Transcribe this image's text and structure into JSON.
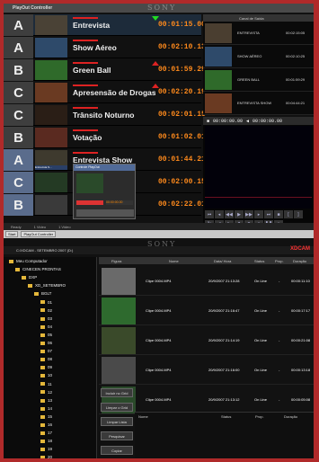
{
  "window": {
    "title": "PlayOut Controller",
    "brand": "SONY"
  },
  "playlist": [
    {
      "letter": "A",
      "name": "Entrevista",
      "tc": "00:01:15.00",
      "thumb": "#4a4236",
      "mark": "green"
    },
    {
      "letter": "A",
      "name": "Show Aéreo",
      "tc": "00:02:10.13",
      "thumb": "#2e4a6a",
      "mark": ""
    },
    {
      "letter": "B",
      "name": "Green Ball",
      "tc": "00:01:59.29",
      "thumb": "#2f6a2a",
      "mark": "red"
    },
    {
      "letter": "C",
      "name": "Apresensão de Drogas",
      "tc": "00:02:20.19",
      "thumb": "#6a3a22",
      "mark": "red"
    },
    {
      "letter": "C",
      "name": "Trânsito Noturno",
      "tc": "00:02:01.15",
      "thumb": "#2a1e16",
      "mark": ""
    },
    {
      "letter": "B",
      "name": "Votação",
      "tc": "00:01:02.01",
      "thumb": "#5a2a20",
      "mark": ""
    },
    {
      "letter": "A",
      "name": "Entrevista Show",
      "tc": "00:01:44.21",
      "thumb": "#3e3a2e",
      "mark": ""
    },
    {
      "letter": "C",
      "name": "",
      "tc": "00:02:00.15",
      "thumb": "#243a24",
      "mark": ""
    },
    {
      "letter": "B",
      "name": "",
      "tc": "00:02:22.01",
      "thumb": "#3a3a3a",
      "mark": ""
    }
  ],
  "cliplist": {
    "header": "Canal de Saída",
    "items": [
      {
        "name": "ENTREVISTA",
        "dur": "00:02:15:05",
        "thumb": "#4a3e30"
      },
      {
        "name": "SHOW AÉREO",
        "dur": "00:02:10:25",
        "thumb": "#2e4a6a"
      },
      {
        "name": "GREEN BALL",
        "dur": "00:01:59:29",
        "thumb": "#2f6a2a"
      },
      {
        "name": "ENTREVISTA SHOW",
        "dur": "00:04:44:21",
        "thumb": "#6a3a22"
      }
    ]
  },
  "monitor": {
    "tc_in": "00:00:00.00",
    "tc_out": "00:00:00.00"
  },
  "popup": {
    "title": "Controle PlayOut",
    "overlay": "Entrevista S...",
    "time": "00:00:00.00"
  },
  "statusbar": {
    "left": "Ready",
    "mid": "1 Video",
    "right": "1 Video"
  },
  "taskbar": {
    "start": "Start",
    "app": "PlayOut Controller"
  },
  "bottom": {
    "brand": "SONY",
    "address": "C:\\XDCAM - SETEMBRO 2007 (D:)",
    "logo": "XDCAM"
  },
  "tree": [
    {
      "label": "Meu Computador"
    },
    {
      "label": "CINECEN PRONTAS"
    },
    {
      "label": "DXP"
    },
    {
      "label": "XD_SETEMBRO"
    },
    {
      "label": "BGLT"
    },
    {
      "label": "01"
    },
    {
      "label": "02"
    },
    {
      "label": "03"
    },
    {
      "label": "04"
    },
    {
      "label": "05"
    },
    {
      "label": "06"
    },
    {
      "label": "07"
    },
    {
      "label": "08"
    },
    {
      "label": "09"
    },
    {
      "label": "10"
    },
    {
      "label": "11"
    },
    {
      "label": "12"
    },
    {
      "label": "13"
    },
    {
      "label": "14"
    },
    {
      "label": "15"
    },
    {
      "label": "16"
    },
    {
      "label": "17"
    },
    {
      "label": "18"
    },
    {
      "label": "19"
    },
    {
      "label": "20"
    }
  ],
  "grid": {
    "headers": {
      "thumb": "Figura",
      "name": "Nome",
      "date": "Data/ Hora",
      "status": "Status",
      "prop": "Prop.",
      "dur": "Duração"
    },
    "rows": [
      {
        "name": "Clipe 0004.MP4",
        "date": "20/9/2007 21:13:28",
        "status": "On Line",
        "prop": "-",
        "dur": "00:00:11:10",
        "thumb": "#6a6a6a"
      },
      {
        "name": "Clipe 0004.MP4",
        "date": "20/9/2007 21:16:47",
        "status": "On Line",
        "prop": "-",
        "dur": "00:00:17:17",
        "thumb": "#2e6a2e"
      },
      {
        "name": "Clipe 0004.MP4",
        "date": "20/9/2007 21:14:19",
        "status": "On Line",
        "prop": "-",
        "dur": "00:00:21:08",
        "thumb": "#3a4a2a"
      },
      {
        "name": "Clipe 0004.MP4",
        "date": "20/9/2007 21:16:00",
        "status": "On Line",
        "prop": "-",
        "dur": "00:00:13:18",
        "thumb": "#4a4a4a"
      },
      {
        "name": "Clipe 0004.MP4",
        "date": "20/9/2007 21:13:12",
        "status": "On Line",
        "prop": "-",
        "dur": "00:00:05:08",
        "thumb": "#2a4a2a"
      }
    ]
  },
  "actions": [
    "Incluir no Grid",
    "Limpar o Grid",
    "Limpar Lista",
    "Pesquisar",
    "Copiar",
    "Apagar Material"
  ],
  "list2": {
    "headers": {
      "name": "Nome",
      "status": "Status",
      "prop": "Prop.",
      "dur": "Duração"
    }
  }
}
